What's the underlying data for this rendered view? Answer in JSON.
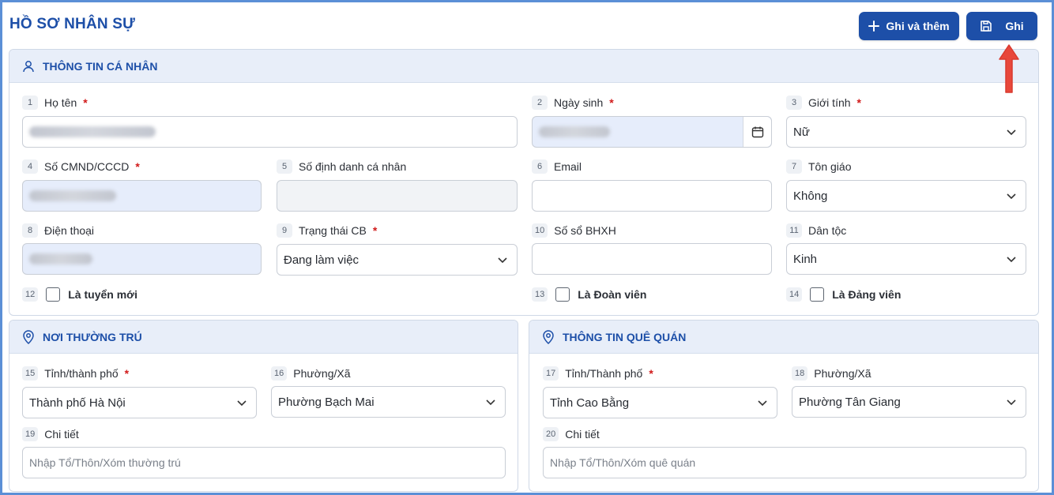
{
  "page": {
    "title": "HỒ SƠ NHÂN SỰ",
    "add_button": "Ghi và thêm",
    "save_button": "Ghi",
    "accent_color": "#1d4fa8"
  },
  "personal": {
    "heading": "THÔNG TIN CÁ NHÂN",
    "fields": {
      "ho_ten": {
        "num": "1",
        "label": "Họ tên",
        "required": "*"
      },
      "ngay_sinh": {
        "num": "2",
        "label": "Ngày sinh",
        "required": "*"
      },
      "gioi_tinh": {
        "num": "3",
        "label": "Giới tính",
        "required": "*",
        "value": "Nữ"
      },
      "cmnd": {
        "num": "4",
        "label": "Số CMND/CCCD",
        "required": "*"
      },
      "dinh_danh": {
        "num": "5",
        "label": "Số định danh cá nhân"
      },
      "email": {
        "num": "6",
        "label": "Email"
      },
      "ton_giao": {
        "num": "7",
        "label": "Tôn giáo",
        "value": "Không"
      },
      "dien_thoai": {
        "num": "8",
        "label": "Điện thoại"
      },
      "trang_thai": {
        "num": "9",
        "label": "Trạng thái CB",
        "required": "*",
        "value": "Đang làm việc"
      },
      "bhxh": {
        "num": "10",
        "label": "Số sổ BHXH"
      },
      "dan_toc": {
        "num": "11",
        "label": "Dân tộc",
        "value": "Kinh"
      },
      "tuyen_moi": {
        "num": "12",
        "label": "Là tuyển mới"
      },
      "doan_vien": {
        "num": "13",
        "label": "Là Đoàn viên"
      },
      "dang_vien": {
        "num": "14",
        "label": "Là Đảng viên"
      }
    }
  },
  "residence": {
    "heading": "NƠI THƯỜNG TRÚ",
    "province": {
      "num": "15",
      "label": "Tỉnh/thành phố",
      "required": "*",
      "value": "Thành phố Hà Nội"
    },
    "ward": {
      "num": "16",
      "label": "Phường/Xã",
      "value": "Phường Bạch Mai"
    },
    "detail": {
      "num": "19",
      "label": "Chi tiết",
      "placeholder": "Nhập Tổ/Thôn/Xóm thường trú"
    }
  },
  "hometown": {
    "heading": "THÔNG TIN QUÊ QUÁN",
    "province": {
      "num": "17",
      "label": "Tỉnh/Thành phố",
      "required": "*",
      "value": "Tỉnh Cao Bằng"
    },
    "ward": {
      "num": "18",
      "label": "Phường/Xã",
      "value": "Phường Tân Giang"
    },
    "detail": {
      "num": "20",
      "label": "Chi tiết",
      "placeholder": "Nhập Tổ/Thôn/Xóm quê quán"
    }
  }
}
